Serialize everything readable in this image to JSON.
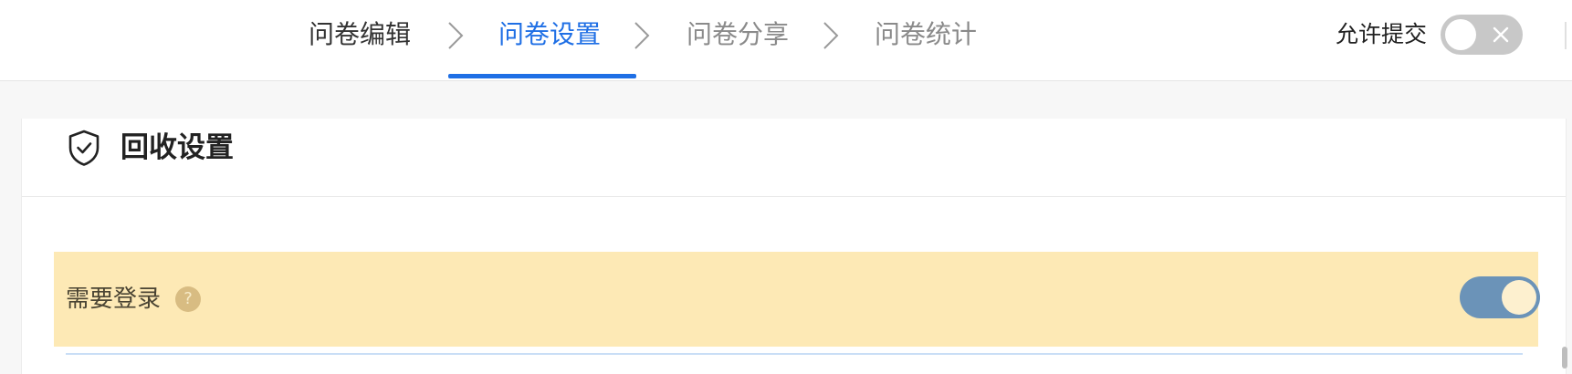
{
  "steps": [
    {
      "label": "问卷编辑",
      "state": "done"
    },
    {
      "label": "问卷设置",
      "state": "active"
    },
    {
      "label": "问卷分享",
      "state": "pending"
    },
    {
      "label": "问卷统计",
      "state": "pending"
    }
  ],
  "header": {
    "allow_submit_label": "允许提交",
    "allow_submit_on": false
  },
  "section": {
    "title": "回收设置",
    "icon": "shield-check-icon"
  },
  "settings": [
    {
      "label": "需要登录",
      "help": "?",
      "enabled": true
    }
  ],
  "colors": {
    "accent": "#1f6fe5",
    "highlight_row": "#fde9b5",
    "toggle_on": "#6b93b8",
    "toggle_off": "#c8c8c8"
  }
}
